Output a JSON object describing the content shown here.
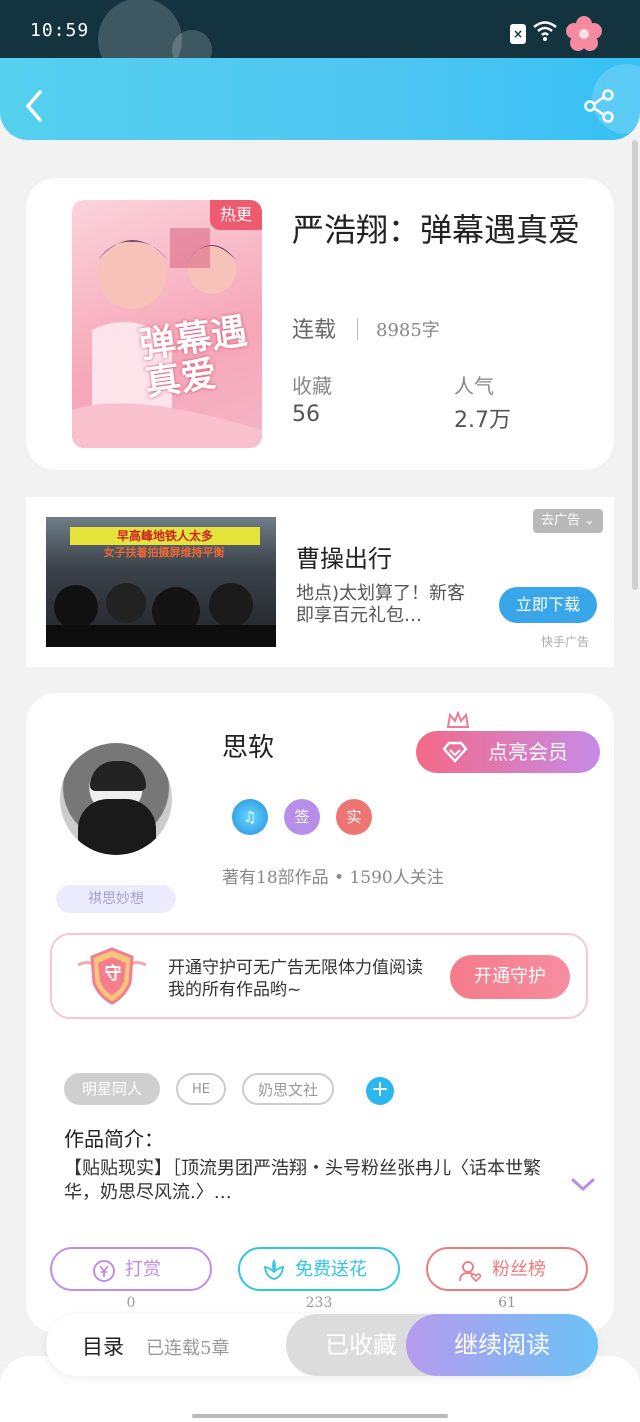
{
  "status_bar": {
    "time": "10:59"
  },
  "book": {
    "title": "严浩翔：弹幕遇真爱",
    "cover_tag": "热更",
    "cover_text": "弹幕遇真爱",
    "status": "连载",
    "words": "8985字",
    "stats": [
      {
        "label": "收藏",
        "value": "56"
      },
      {
        "label": "人气",
        "value": "2.7万"
      }
    ]
  },
  "ad": {
    "close_label": "去广告",
    "banner_line1": "早高峰地铁人太多",
    "banner_line2": "女子扶着拍摄屏维持平衡",
    "title": "曹操出行",
    "description": "地点)太划算了！新客即享百元礼包…",
    "button": "立即下载",
    "source": "快手广告"
  },
  "author": {
    "name": "思软",
    "vip_button": "点亮会员",
    "badges": [
      "♫",
      "签",
      "实"
    ],
    "meta": "著有18部作品 • 1590人关注",
    "avatar_badge": "祺思妙想",
    "guard_icon_text": "守",
    "guard_text": "开通守护可无广告无限体力值阅读我的所有作品哟~",
    "guard_button": "开通守护"
  },
  "tags": [
    "明星同人",
    "HE",
    "奶思文社"
  ],
  "intro": {
    "label": "作品简介：",
    "text": "【贴贴现实】［顶流男团严浩翔・头号粉丝张冉儿〈话本世繁华，奶思尽风流.〉…"
  },
  "actions": [
    {
      "label": "打赏",
      "count": "0",
      "color": "#c58be8",
      "icon": "yen-icon"
    },
    {
      "label": "免费送花",
      "count": "233",
      "color": "#34c6e0",
      "icon": "flower-icon"
    },
    {
      "label": "粉丝榜",
      "count": "61",
      "color": "#ee7a80",
      "icon": "fans-icon"
    }
  ],
  "bottom": {
    "toc": "目录",
    "chapters": "已连载5章",
    "collected": "已收藏",
    "continue": "继续阅读"
  }
}
